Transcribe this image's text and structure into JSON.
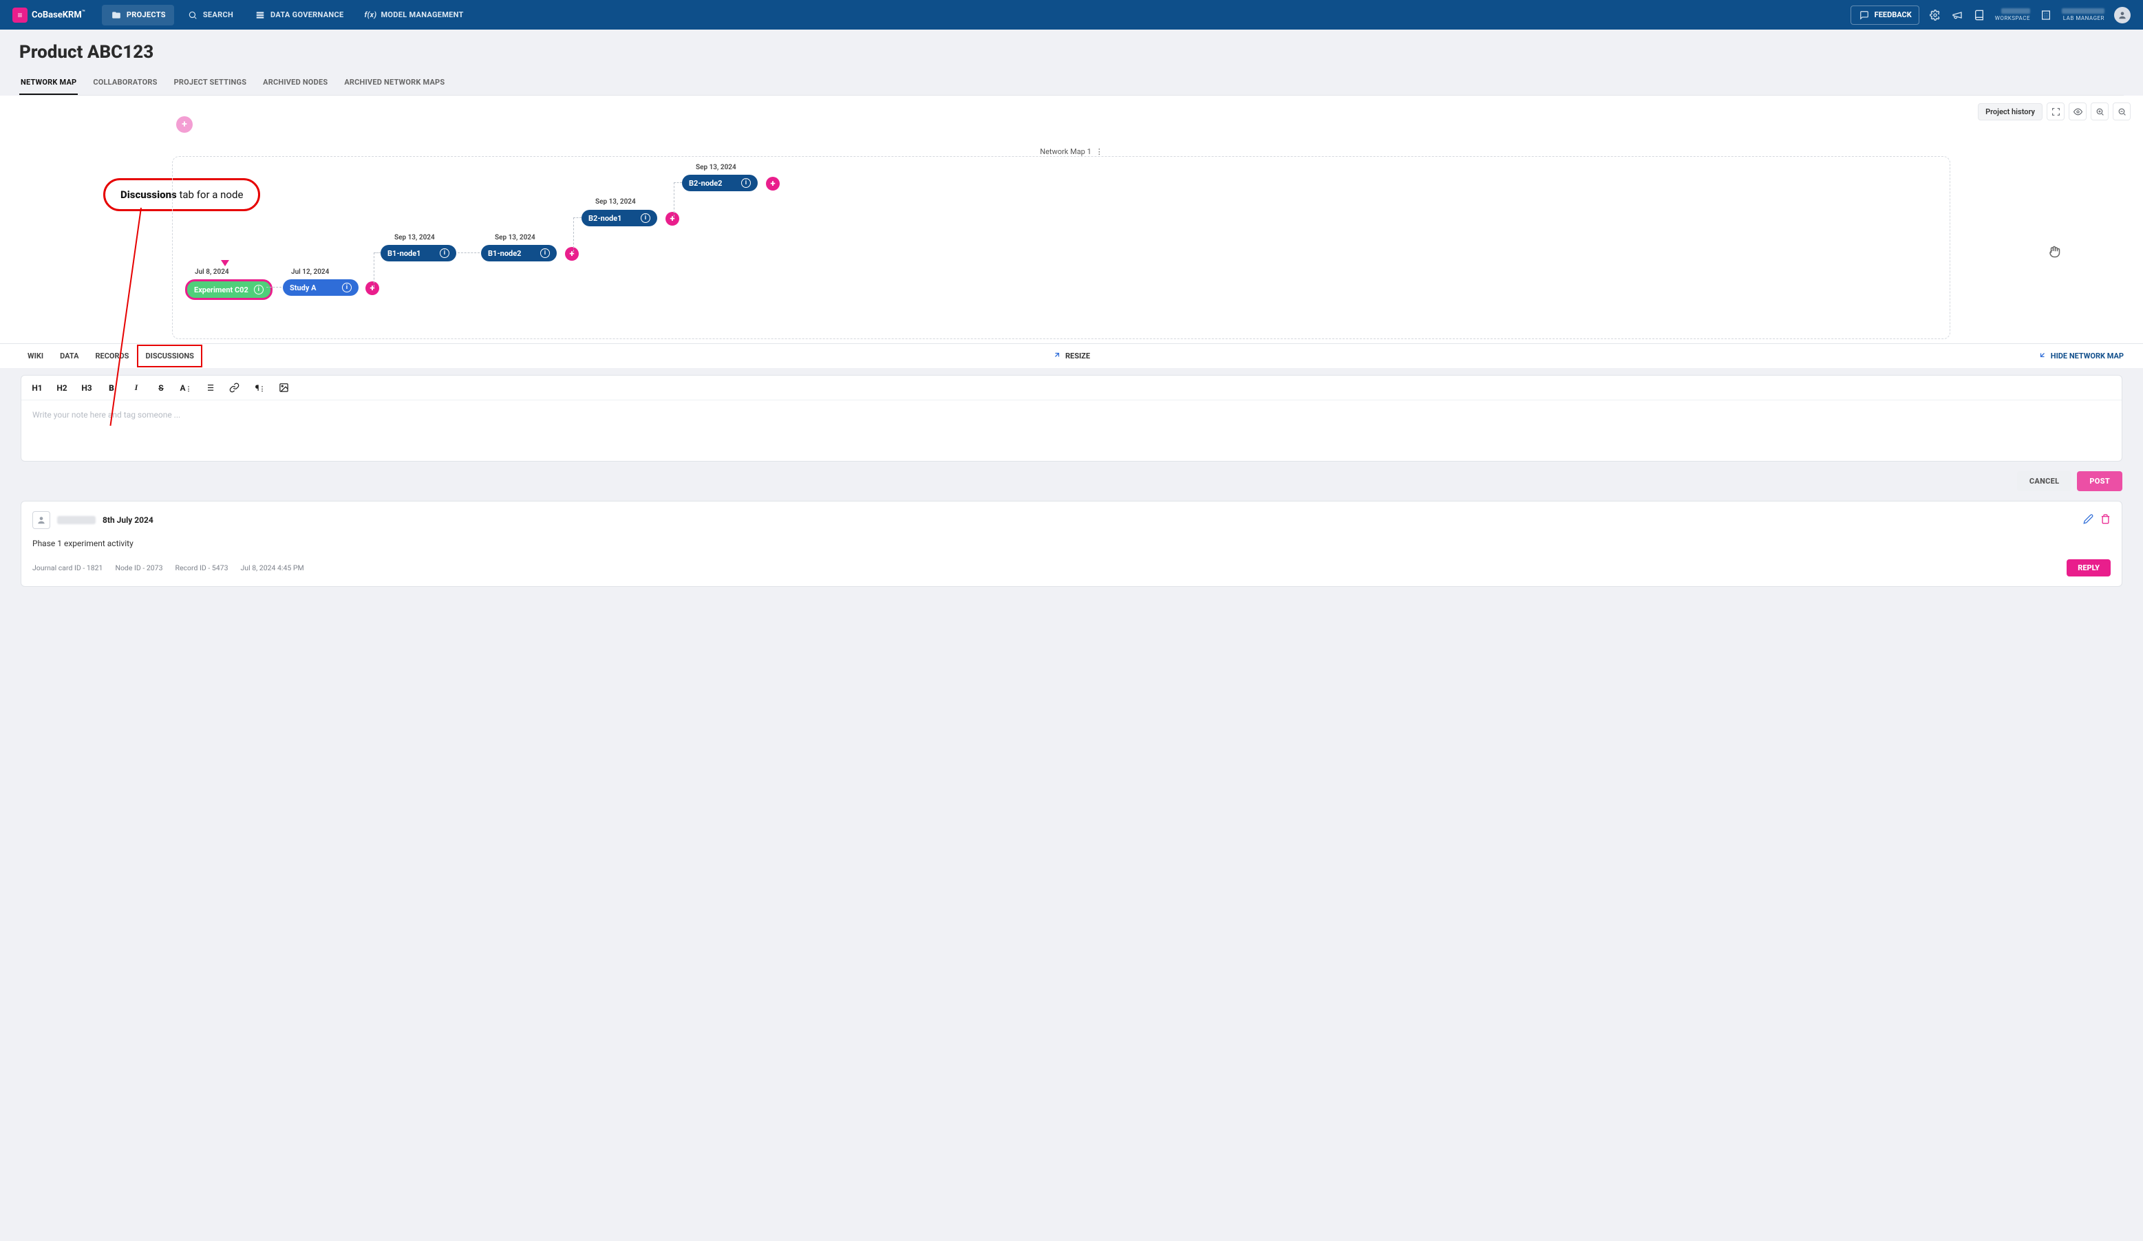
{
  "brand": "CoBaseKRM",
  "nav": {
    "projects": "PROJECTS",
    "search": "SEARCH",
    "governance": "DATA GOVERNANCE",
    "model": "MODEL MANAGEMENT",
    "feedback": "FEEDBACK",
    "workspace_label": "WORKSPACE",
    "role_label": "LAB MANAGER"
  },
  "page": {
    "title": "Product ABC123"
  },
  "subtabs": {
    "network_map": "NETWORK MAP",
    "collaborators": "COLLABORATORS",
    "project_settings": "PROJECT SETTINGS",
    "archived_nodes": "ARCHIVED NODES",
    "archived_maps": "ARCHIVED NETWORK MAPS"
  },
  "toolbar": {
    "history": "Project history"
  },
  "map": {
    "title": "Network Map 1",
    "nodes": {
      "exp": {
        "label": "Experiment C02",
        "date": "Jul 8, 2024"
      },
      "study": {
        "label": "Study A",
        "date": "Jul 12, 2024"
      },
      "b1n1": {
        "label": "B1-node1",
        "date": "Sep 13, 2024"
      },
      "b1n2": {
        "label": "B1-node2",
        "date": "Sep 13, 2024"
      },
      "b2n1": {
        "label": "B2-node1",
        "date": "Sep 13, 2024"
      },
      "b2n2": {
        "label": "B2-node2",
        "date": "Sep 13, 2024"
      }
    }
  },
  "annotation": {
    "bold": "Discussions",
    "rest": " tab for a node"
  },
  "lower_tabs": {
    "wiki": "WIKI",
    "data": "DATA",
    "records": "RECORDS",
    "discussions": "DISCUSSIONS"
  },
  "resize": "RESIZE",
  "hide_map": "HIDE NETWORK MAP",
  "editor": {
    "h1": "H1",
    "h2": "H2",
    "h3": "H3",
    "b": "B",
    "i": "I",
    "s": "S",
    "a": "A",
    "placeholder": "Write your note here and tag someone ...",
    "cancel": "CANCEL",
    "post": "POST"
  },
  "discussion": {
    "date": "8th July 2024",
    "body": "Phase 1 experiment activity",
    "meta": {
      "journal": "Journal card ID - 1821",
      "node": "Node ID - 2073",
      "record": "Record ID - 5473",
      "ts": "Jul 8, 2024 4:45 PM"
    },
    "reply": "REPLY"
  }
}
